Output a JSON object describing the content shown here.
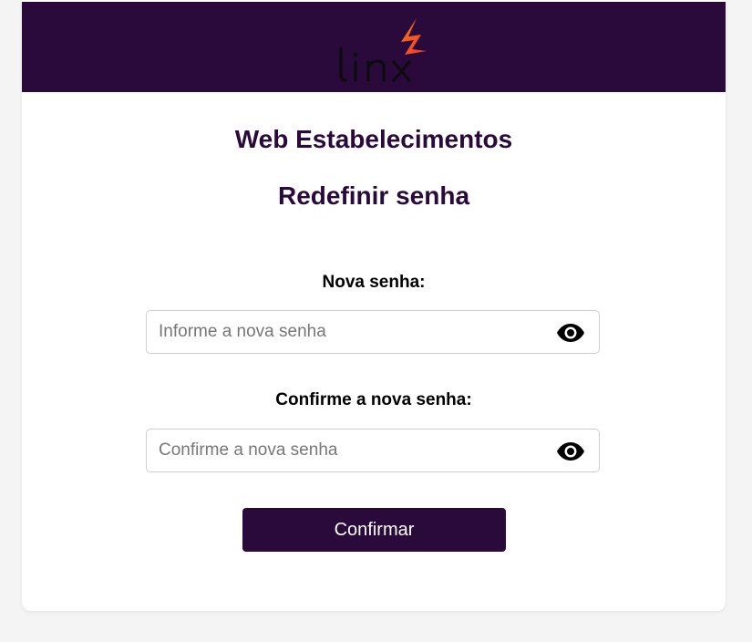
{
  "header": {
    "logo_text": "linx",
    "background_color": "#2a0a3b",
    "logo_accent_colors": [
      "#ff7a1a",
      "#e8362f"
    ]
  },
  "main": {
    "app_title": "Web Estabelecimentos",
    "page_title": "Redefinir senha",
    "new_password": {
      "label": "Nova senha:",
      "placeholder": "Informe a nova senha",
      "value": "",
      "toggle_icon": "eye-icon"
    },
    "confirm_password": {
      "label": "Confirme a nova senha:",
      "placeholder": "Confirme a nova senha",
      "value": "",
      "toggle_icon": "eye-icon"
    },
    "confirm_button": {
      "label": "Confirmar"
    }
  },
  "colors": {
    "primary": "#2a0a3b",
    "page_background": "#f4f4f4",
    "card_background": "#ffffff",
    "input_border": "#cfcfcf"
  }
}
